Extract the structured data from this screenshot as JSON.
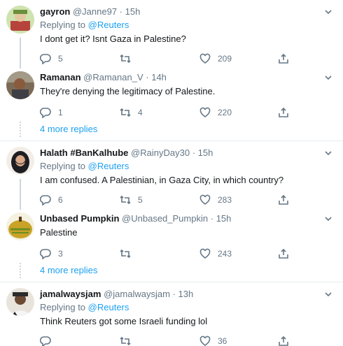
{
  "tweets": [
    {
      "name": "gayron",
      "handle": "@Janne97",
      "time": "15h",
      "replying_prefix": "Replying to",
      "replying_to": "@Reuters",
      "text": "I dont get it? Isnt Gaza in Palestine?",
      "replies": "5",
      "retweets": "",
      "likes": "209"
    },
    {
      "name": "Ramanan",
      "handle": "@Ramanan_V",
      "time": "14h",
      "text": "They're denying the legitimacy of Palestine.",
      "replies": "1",
      "retweets": "4",
      "likes": "220"
    },
    {
      "name": "Halath #BanKalhube",
      "handle": "@RainyDay30",
      "time": "15h",
      "replying_prefix": "Replying to",
      "replying_to": "@Reuters",
      "text": "I am confused. A Palestinian, in Gaza City, in which country?",
      "replies": "6",
      "retweets": "5",
      "likes": "283"
    },
    {
      "name": "Unbased Pumpkin",
      "handle": "@Unbased_Pumpkin",
      "time": "15h",
      "text": "Palestine",
      "replies": "3",
      "retweets": "",
      "likes": "243"
    },
    {
      "name": "jamalwaysjam",
      "handle": "@jamalwaysjam",
      "time": "13h",
      "replying_prefix": "Replying to",
      "replying_to": "@Reuters",
      "text": "Think Reuters got some Israeli funding lol",
      "replies": "",
      "retweets": "",
      "likes": "36"
    }
  ],
  "more_replies": [
    "4 more replies",
    "4 more replies"
  ],
  "separator": "·",
  "colors": {
    "accent": "#1da1f2",
    "muted": "#657786",
    "border": "#e6ecf0"
  }
}
